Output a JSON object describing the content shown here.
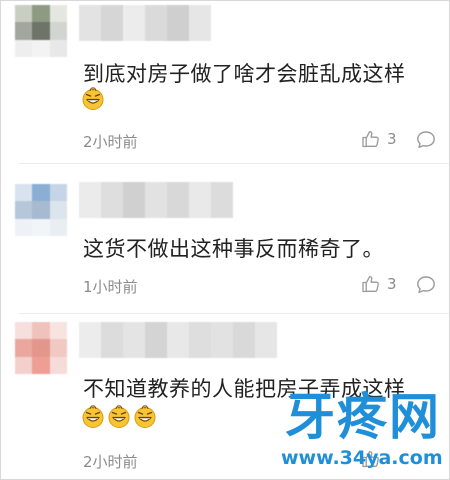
{
  "comments": [
    {
      "avatar_colors": [
        "#c9cec3",
        "#8f9a82",
        "#e4e7e0",
        "#a3a69f",
        "#6e7468",
        "#d2d5cf",
        "#eeeeee",
        "#f3f3f3",
        "#e8e8e8"
      ],
      "username_colors": [
        "#e3e3e3",
        "#d6d6d6",
        "#ececec",
        "#dadada",
        "#cfcfcf",
        "#e6e6e6"
      ],
      "text": "到底对房子做了啥才会脏乱成这样",
      "emojis": [
        "grin-emoji"
      ],
      "time": "2小时前",
      "likes": "3"
    },
    {
      "avatar_colors": [
        "#d9e3ee",
        "#8aaed4",
        "#c5d5e6",
        "#b7c7da",
        "#a6bad0",
        "#dce4ee",
        "#eef2f6",
        "#f2f5f8",
        "#e9eef3"
      ],
      "username_colors": [
        "#ebebeb",
        "#dedede",
        "#d0d0d0",
        "#e2e2e2",
        "#d8d8d8",
        "#e9e9e9",
        "#dcdcdc"
      ],
      "text": "这货不做出这种事反而稀奇了。",
      "emojis": [],
      "time": "1小时前",
      "likes": "3"
    },
    {
      "avatar_colors": [
        "#f6dfdc",
        "#f0c2bc",
        "#f7e4e1",
        "#e9a79e",
        "#e3968c",
        "#f1c9c3",
        "#f3d0cb",
        "#ee9e94",
        "#f5dcd8"
      ],
      "username_colors": [
        "#ececec",
        "#dcdcdc",
        "#e4e4e4",
        "#d4d4d4",
        "#e8e8e8",
        "#dedede",
        "#e2e2e2",
        "#d9d9d9",
        "#e6e6e6"
      ],
      "text": "不知道教养的人能把房子弄成这样",
      "emojis": [
        "grin-emoji",
        "grin-emoji",
        "grin-emoji"
      ],
      "time": "2小时前",
      "likes": ""
    }
  ],
  "watermark": {
    "logo": "牙疼网",
    "url": "www.34ya.com"
  },
  "colors": {
    "text": "#222222",
    "meta": "#8c8c8c",
    "watermark": "#1e8fd8"
  }
}
